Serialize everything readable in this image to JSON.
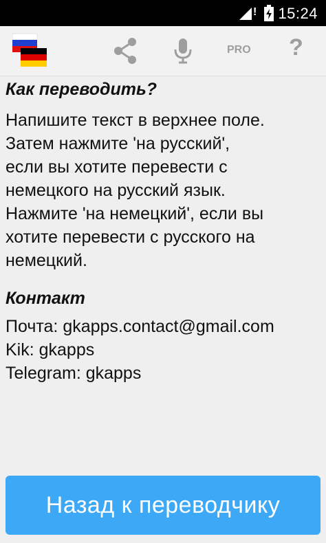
{
  "status_bar": {
    "time": "15:24"
  },
  "action_bar": {
    "app_icon": "flags-ru-de-icon",
    "actions": [
      {
        "name": "share-icon"
      },
      {
        "name": "microphone-icon"
      },
      {
        "name": "pro-button",
        "label": "PRO"
      },
      {
        "name": "help-icon",
        "label": "?"
      }
    ]
  },
  "help": {
    "how_title": "Как переводить?",
    "how_text": "Напишите текст в верхнее поле.\nЗатем нажмите 'на русский',\nесли вы хотите перевести с\nнемецкого на русский язык.\nНажмите 'на немецкий', если вы\nхотите перевести с русского на\nнемецкий.",
    "contact_title": "Контакт",
    "contact_lines": [
      "Почта: gkapps.contact@gmail.com",
      "Kik: gkapps",
      "Telegram: gkapps"
    ]
  },
  "back_button": {
    "label": "Назад к переводчику"
  },
  "colors": {
    "button": "#3da8f5",
    "background": "#efefef",
    "icon_gray": "#9e9e9e"
  }
}
